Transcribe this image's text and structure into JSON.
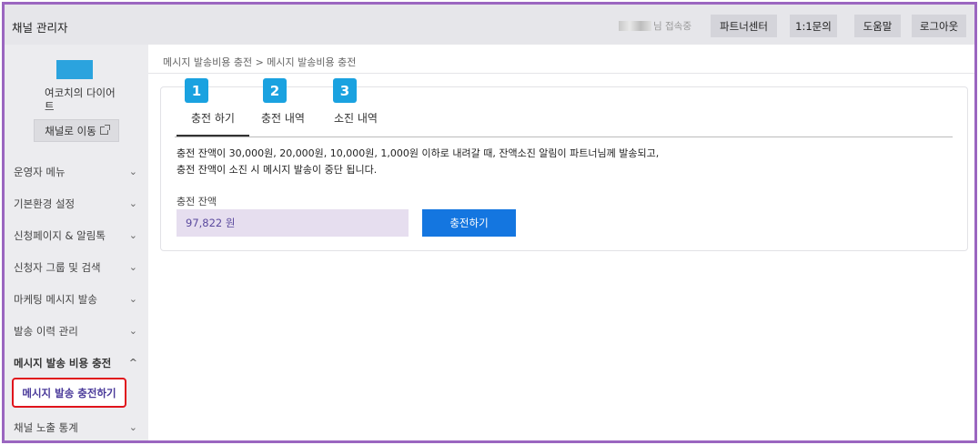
{
  "header": {
    "brand": "채널 관리자",
    "user_suffix": "님 접속중",
    "buttons": [
      "파트너센터",
      "1:1문의",
      "도움말",
      "로그아웃"
    ]
  },
  "sidebar": {
    "channel_name": "여코치의 다이어트",
    "move_button": "채널로 이동",
    "menu": [
      {
        "label": "운영자 메뉴",
        "chevron": "⌄"
      },
      {
        "label": "기본환경 설정",
        "chevron": "⌄"
      },
      {
        "label": "신청페이지 & 알림톡",
        "chevron": "⌄"
      },
      {
        "label": "신청자 그룹 및 검색",
        "chevron": "⌄"
      },
      {
        "label": "마케팅 메시지 발송",
        "chevron": "⌄"
      },
      {
        "label": "발송 이력 관리",
        "chevron": "⌄"
      },
      {
        "label": "메시지 발송 비용 충전",
        "chevron": "^"
      },
      {
        "label": "채널 노출 통계",
        "chevron": "⌄"
      }
    ],
    "active_sub_item": "메시지 발송 충전하기"
  },
  "main": {
    "breadcrumb": "메시지 발송비용 충전 > 메시지 발송비용 충전",
    "tabs": [
      {
        "badge": "1",
        "label": "충전 하기"
      },
      {
        "badge": "2",
        "label": "충전 내역"
      },
      {
        "badge": "3",
        "label": "소진 내역"
      }
    ],
    "notice_line1": "충전 잔액이 30,000원, 20,000원, 10,000원, 1,000원 이하로 내려갈 때, 잔액소진 알림이 파트너님께 발송되고,",
    "notice_line2": "충전 잔액이 소진 시 메시지 발송이 중단 됩니다.",
    "balance_label": "충전 잔액",
    "balance_value": "97,822 원",
    "charge_button": "충전하기"
  },
  "colors": {
    "frame_border": "#9b66c0",
    "badge": "#1aa2e0",
    "primary_button": "#1476e0",
    "highlight_border": "#e0141c",
    "balance_field": "#e6deef"
  }
}
